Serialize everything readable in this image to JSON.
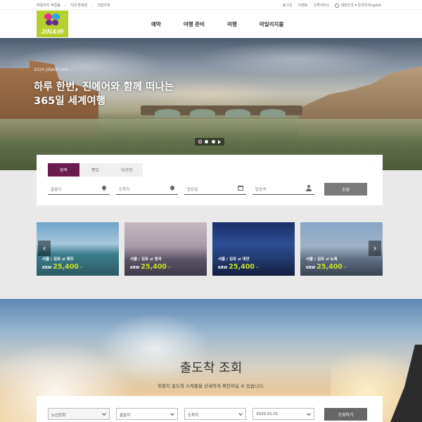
{
  "topbar": {
    "left_links": [
      "마일리지 적립률",
      "기내 면세점",
      "기업우대"
    ],
    "right_links": [
      "로그인",
      "이벤트",
      "고객서비스"
    ],
    "region": "대한민국 ▾  한국어 English"
  },
  "header": {
    "logo_text": "JINAIR",
    "nav": [
      "예약",
      "여행 준비",
      "여행",
      "마일리지몰"
    ]
  },
  "hero": {
    "eyebrow": "2020 JINAIR LIFE ~",
    "headline": "하루 한번, 진에어와 함께 떠나는 365일 세계여행",
    "slides": 3,
    "active_slide": 1
  },
  "booking": {
    "tabs": [
      "왕복",
      "편도",
      "다구간"
    ],
    "active_tab": "왕복",
    "fields": {
      "origin": "출발지",
      "destination": "도착지",
      "depart_date": "탑승일",
      "passengers": "탑승객"
    },
    "search_label": "조회"
  },
  "cards": [
    {
      "route": "서울 / 김포 ⇄ 제주",
      "currency": "KRW",
      "price": "25,400",
      "suffix": "~"
    },
    {
      "route": "서울 / 김포 ⇄ 영국",
      "currency": "KRW",
      "price": "25,400",
      "suffix": "~"
    },
    {
      "route": "서울 / 김포 ⇄ 대만",
      "currency": "KRW",
      "price": "25,400",
      "suffix": "~"
    },
    {
      "route": "서울 / 김포 ⇄ 뉴욕",
      "currency": "KRW",
      "price": "25,400",
      "suffix": "~"
    }
  ],
  "schedule": {
    "title": "출도착 조회",
    "subtitle": "취항지 출도착 스케줄을 상세하게 확인하실 수 있습니다.",
    "route_type": "노선조회",
    "origin": "출발지",
    "destination": "도착지",
    "date": "2020.01.01",
    "button_label": "조회하기"
  },
  "colors": {
    "brand_purple": "#6b1c4e",
    "logo_green": "#b4cf2e",
    "price_green": "#c5e02a"
  }
}
